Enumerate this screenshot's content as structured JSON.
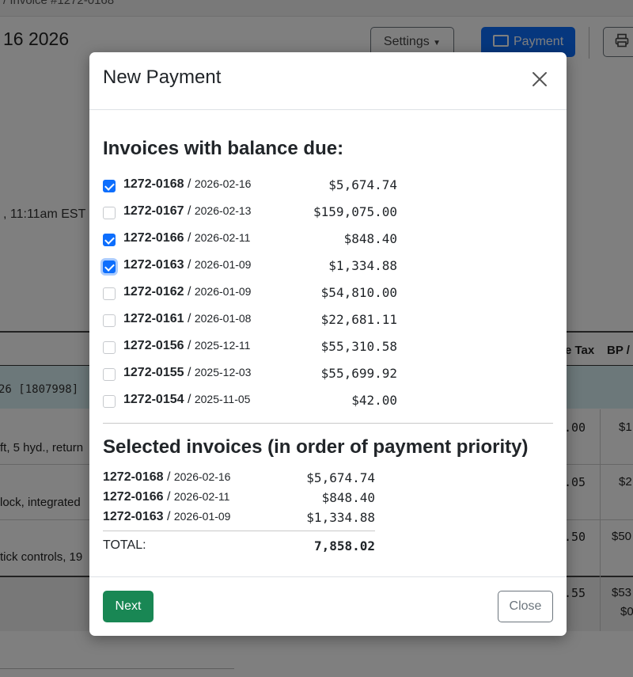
{
  "background": {
    "breadcrumb": "/ Invoice #1272-0168",
    "page_title": "16 2026",
    "settings_label": "Settings",
    "payment_label": "Payment",
    "timestamp": ", 11:11am EST",
    "table_headers": [
      "e Tax",
      "BP /"
    ],
    "band_text": "26 [1807998]",
    "rows": [
      {
        "desc": "ft, 5 hyd., return",
        "tax": ".00",
        "bp": "$1"
      },
      {
        "desc": "lock, integrated",
        "tax": ".05",
        "bp": "$2"
      },
      {
        "desc": "tick controls, 19",
        "tax": ".50",
        "bp": "$50"
      }
    ],
    "footer_tax": ".55",
    "footer_bp": [
      "$53",
      "$0"
    ]
  },
  "modal": {
    "title": "New Payment",
    "section_balance_title": "Invoices with balance due:",
    "invoices": [
      {
        "number": "1272-0168",
        "date": "2026-02-16",
        "amount": "$5,674.74",
        "checked": true
      },
      {
        "number": "1272-0167",
        "date": "2026-02-13",
        "amount": "$159,075.00",
        "checked": false
      },
      {
        "number": "1272-0166",
        "date": "2026-02-11",
        "amount": "$848.40",
        "checked": true
      },
      {
        "number": "1272-0163",
        "date": "2026-01-09",
        "amount": "$1,334.88",
        "checked": true,
        "focused": true
      },
      {
        "number": "1272-0162",
        "date": "2026-01-09",
        "amount": "$54,810.00",
        "checked": false
      },
      {
        "number": "1272-0161",
        "date": "2026-01-08",
        "amount": "$22,681.11",
        "checked": false
      },
      {
        "number": "1272-0156",
        "date": "2025-12-11",
        "amount": "$55,310.58",
        "checked": false
      },
      {
        "number": "1272-0155",
        "date": "2025-12-03",
        "amount": "$55,699.92",
        "checked": false
      },
      {
        "number": "1272-0154",
        "date": "2025-11-05",
        "amount": "$42.00",
        "checked": false
      }
    ],
    "section_selected_title": "Selected invoices (in order of payment priority)",
    "selected": [
      {
        "number": "1272-0168",
        "date": "2026-02-16",
        "amount": "$5,674.74"
      },
      {
        "number": "1272-0166",
        "date": "2026-02-11",
        "amount": "$848.40"
      },
      {
        "number": "1272-0163",
        "date": "2026-01-09",
        "amount": "$1,334.88"
      }
    ],
    "total_label": "TOTAL:",
    "total_value": "7,858.02",
    "next_label": "Next",
    "close_label": "Close"
  },
  "colors": {
    "primary": "#0d6efd",
    "success": "#198754",
    "secondary": "#6c757d",
    "band": "#d8f0f4"
  }
}
